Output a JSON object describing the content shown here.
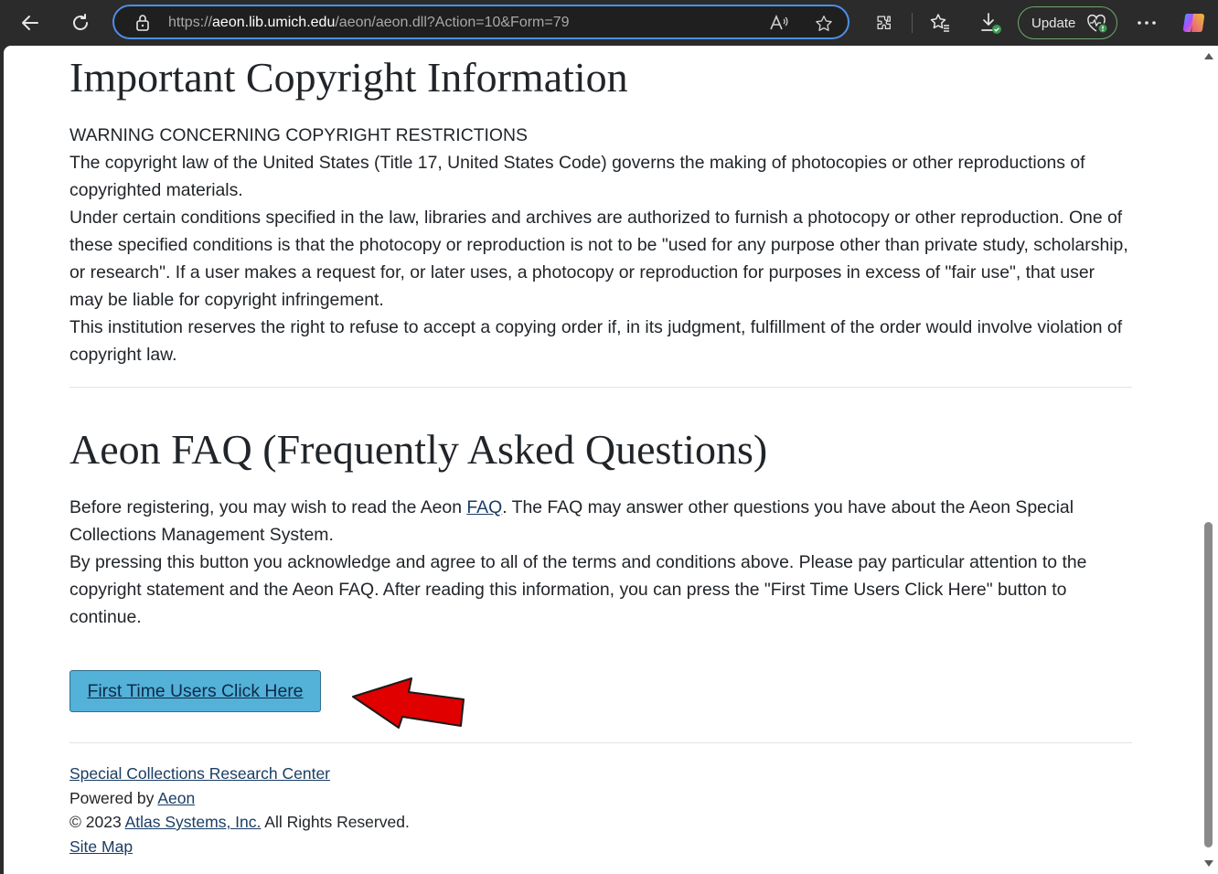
{
  "browser": {
    "url_scheme": "https://",
    "url_host": "aeon.lib.umich.edu",
    "url_path": "/aeon/aeon.dll?Action=10&Form=79",
    "update_label": "Update"
  },
  "copyright": {
    "title": "Important Copyright Information",
    "warning": "WARNING CONCERNING COPYRIGHT RESTRICTIONS",
    "para1": "The copyright law of the United States (Title 17, United States Code) governs the making of photocopies or other reproductions of copyrighted materials.",
    "para2": "Under certain conditions specified in the law, libraries and archives are authorized to furnish a photocopy or other reproduction. One of these specified conditions is that the photocopy or reproduction is not to be \"used for any purpose other than private study, scholarship, or research\". If a user makes a request for, or later uses, a photocopy or reproduction for purposes in excess of \"fair use\", that user may be liable for copyright infringement.",
    "para3": "This institution reserves the right to refuse to accept a copying order if, in its judgment, fulfillment of the order would involve violation of copyright law."
  },
  "faq": {
    "title": "Aeon FAQ (Frequently Asked Questions)",
    "para1_before": "Before registering, you may wish to read the Aeon ",
    "para1_link": "FAQ",
    "para1_after": ". The FAQ may answer other questions you have about the Aeon Special Collections Management System.",
    "para2": "By pressing this button you acknowledge and agree to all of the terms and conditions above. Please pay particular attention to the copyright statement and the Aeon FAQ. After reading this information, you can press the \"First Time Users Click Here\" button to continue."
  },
  "cta": {
    "label": "First Time Users Click Here"
  },
  "footer": {
    "research_center": "Special Collections Research Center",
    "powered_by": "Powered by ",
    "aeon_link": "Aeon",
    "copyright_prefix": "© 2023 ",
    "atlas_link": "Atlas Systems, Inc.",
    "rights": " All Rights Reserved.",
    "site_map": "Site Map"
  },
  "icons": [
    "back-icon",
    "refresh-icon",
    "lock-icon",
    "read-aloud-icon",
    "favorite-star-icon",
    "extensions-icon",
    "favorites-icon",
    "downloads-icon",
    "heart-icon",
    "more-icon",
    "copilot-icon",
    "red-arrow-annotation"
  ],
  "colors": {
    "button_bg": "#54b1d8",
    "arrow": "#e00000",
    "address_border": "#4d8fe6"
  }
}
